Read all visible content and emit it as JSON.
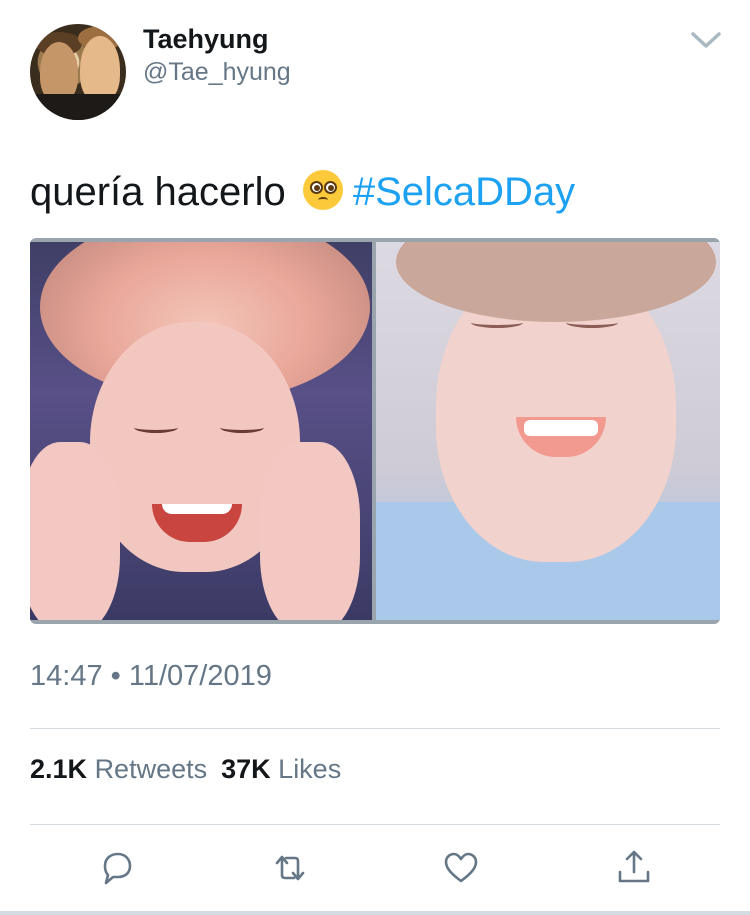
{
  "author": {
    "display_name": "Taehyung",
    "handle": "@Tae_hyung"
  },
  "tweet": {
    "text": "quería hacerlo",
    "emoji": "🥺",
    "hashtag": "#SelcaDDay"
  },
  "meta": {
    "timestamp": "14:47 • 11/07/2019"
  },
  "stats": {
    "retweets_count": "2.1K",
    "retweets_label": "Retweets",
    "likes_count": "37K",
    "likes_label": "Likes"
  },
  "icons": {
    "menu": "chevron-down-icon",
    "reply": "reply-icon",
    "retweet": "retweet-icon",
    "like": "heart-icon",
    "share": "share-icon"
  },
  "colors": {
    "link": "#1da1f2",
    "secondary_text": "#657786",
    "primary_text": "#14171a",
    "divider": "#d4dbe1"
  }
}
